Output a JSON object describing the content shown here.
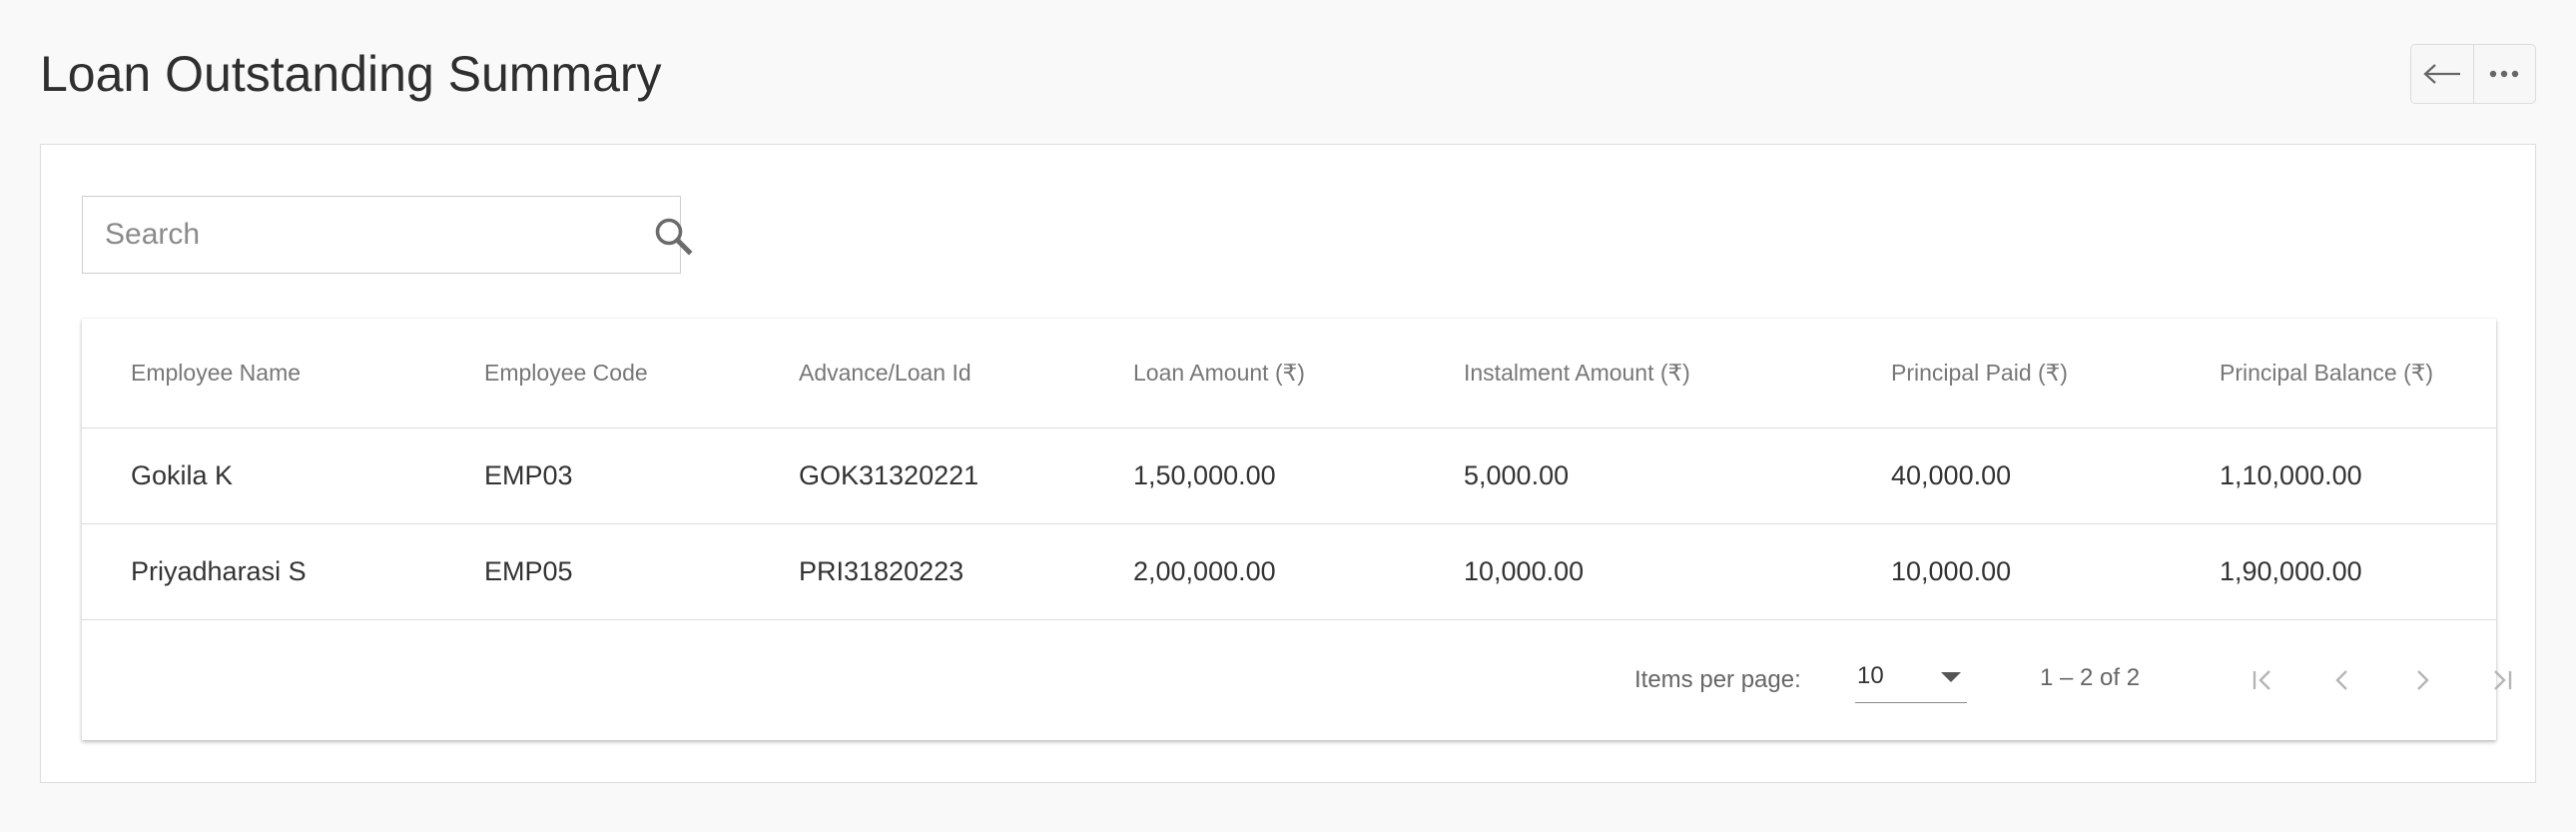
{
  "page": {
    "title": "Loan Outstanding Summary"
  },
  "actions": {
    "back_icon": "arrow-left-icon",
    "more_icon": "more-horizontal-icon"
  },
  "search": {
    "placeholder": "Search",
    "value": "",
    "icon": "search-icon"
  },
  "table": {
    "columns": [
      "Employee Name",
      "Employee Code",
      "Advance/Loan Id",
      "Loan Amount (₹)",
      "Instalment Amount (₹)",
      "Principal Paid (₹)",
      "Principal Balance (₹)"
    ],
    "rows": [
      [
        "Gokila K",
        "EMP03",
        "GOK31320221",
        "1,50,000.00",
        "5,000.00",
        "40,000.00",
        "1,10,000.00"
      ],
      [
        "Priyadharasi S",
        "EMP05",
        "PRI31820223",
        "2,00,000.00",
        "10,000.00",
        "10,000.00",
        "1,90,000.00"
      ]
    ]
  },
  "paginator": {
    "items_per_page_label": "Items per page:",
    "items_per_page_value": "10",
    "range_label": "1 – 2 of 2",
    "icons": [
      "first-page-icon",
      "previous-page-icon",
      "next-page-icon",
      "last-page-icon"
    ]
  },
  "colors": {
    "icon": "#666666",
    "icon_disabled": "#b5b5b5",
    "border": "#dcdcdc"
  }
}
